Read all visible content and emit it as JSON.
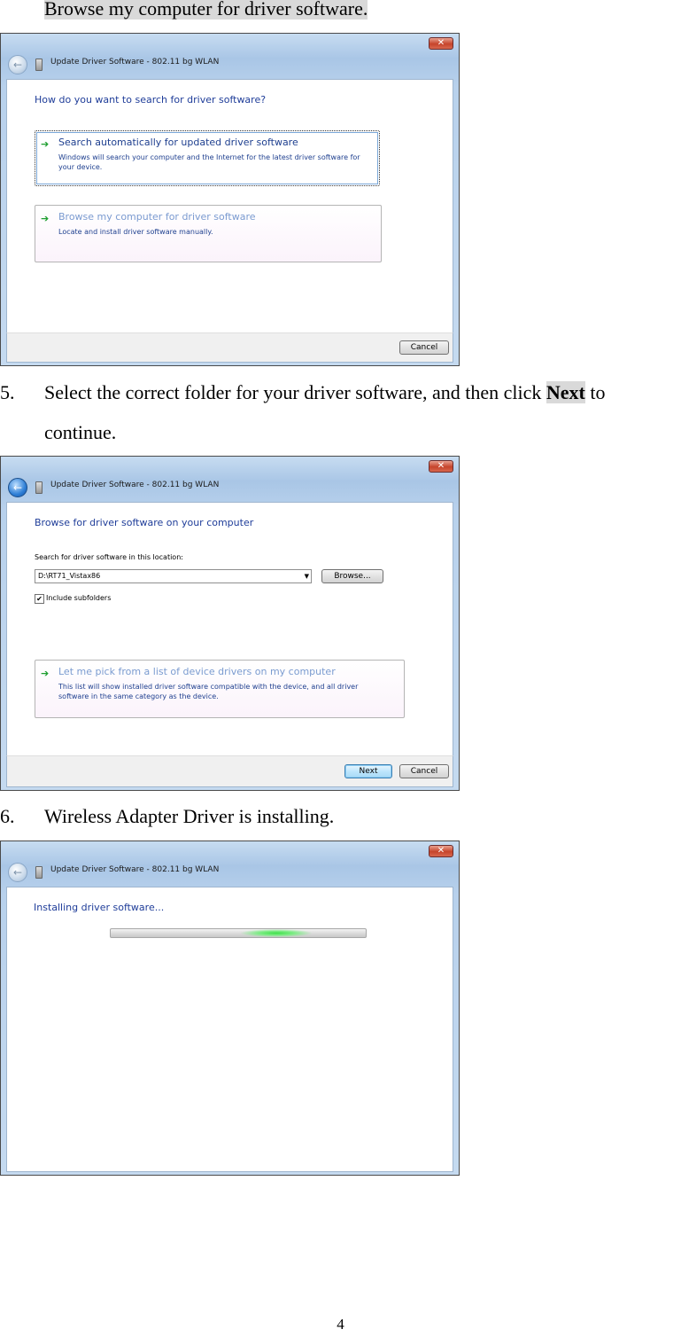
{
  "top_line": "Browse my computer for driver software.",
  "step5": {
    "number": "5.",
    "text_before": "Select the correct folder for your driver software, and then click ",
    "bold": "Next",
    "text_after": " to",
    "line2": "continue."
  },
  "step6": {
    "number": "6.",
    "text": "Wireless Adapter Driver is installing."
  },
  "window_title": "Update Driver Software - 802.11 bg WLAN",
  "close_glyph": "✕",
  "back_glyph": "←",
  "dialog1": {
    "heading": "How do you want to search for driver software?",
    "options": [
      {
        "title": "Search automatically for updated driver software",
        "desc": "Windows will search your computer and the Internet for the latest driver software for your device."
      },
      {
        "title": "Browse my computer for driver software",
        "desc": "Locate and install driver software manually."
      }
    ],
    "cancel": "Cancel"
  },
  "dialog2": {
    "heading": "Browse for driver software on your computer",
    "search_label": "Search for driver software in this location:",
    "path_value": "D:\\RT71_Vistax86",
    "browse": "Browse...",
    "include_subfolders": "Include subfolders",
    "checkbox_checked": true,
    "option": {
      "title": "Let me pick from a list of device drivers on my computer",
      "desc": "This list will show installed driver software compatible with the device, and all driver software in the same category as the device."
    },
    "next": "Next",
    "cancel": "Cancel"
  },
  "dialog3": {
    "heading": "Installing driver software...",
    "progress_fraction": 0.65
  },
  "page_number": "4",
  "icons": {
    "arrow": "green-arrow-icon",
    "back": "back-arrow-icon",
    "close": "close-icon",
    "device": "wlan-device-icon"
  }
}
